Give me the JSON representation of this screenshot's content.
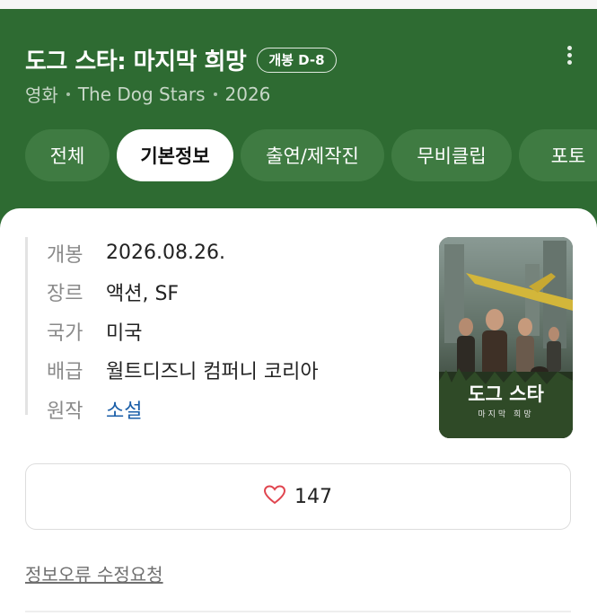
{
  "header": {
    "title": "도그 스타: 마지막 희망",
    "badge": "개봉 D-8",
    "subtitle": {
      "category": "영화",
      "original_title": "The Dog Stars",
      "year": "2026"
    },
    "more_icon": "more-vertical-icon"
  },
  "tabs": [
    {
      "label": "전체",
      "active": false
    },
    {
      "label": "기본정보",
      "active": true
    },
    {
      "label": "출연/제작진",
      "active": false
    },
    {
      "label": "무비클립",
      "active": false
    },
    {
      "label": "포토",
      "active": false
    }
  ],
  "info": [
    {
      "label": "개봉",
      "value": "2026.08.26."
    },
    {
      "label": "장르",
      "value": "액션, SF"
    },
    {
      "label": "국가",
      "value": "미국"
    },
    {
      "label": "배급",
      "value": "월트디즈니 컴퍼니 코리아"
    },
    {
      "label": "원작",
      "value": "소설"
    }
  ],
  "poster": {
    "title": "도그 스타",
    "subtitle": "마지막 희망"
  },
  "like": {
    "icon": "heart-outline-icon",
    "count": "147",
    "color": "#e0454f"
  },
  "report_link": "정보오류 수정요청",
  "colors": {
    "header_bg": "#2e6b32",
    "tab_bg": "#3f7b42",
    "link": "#1a5ea8"
  }
}
